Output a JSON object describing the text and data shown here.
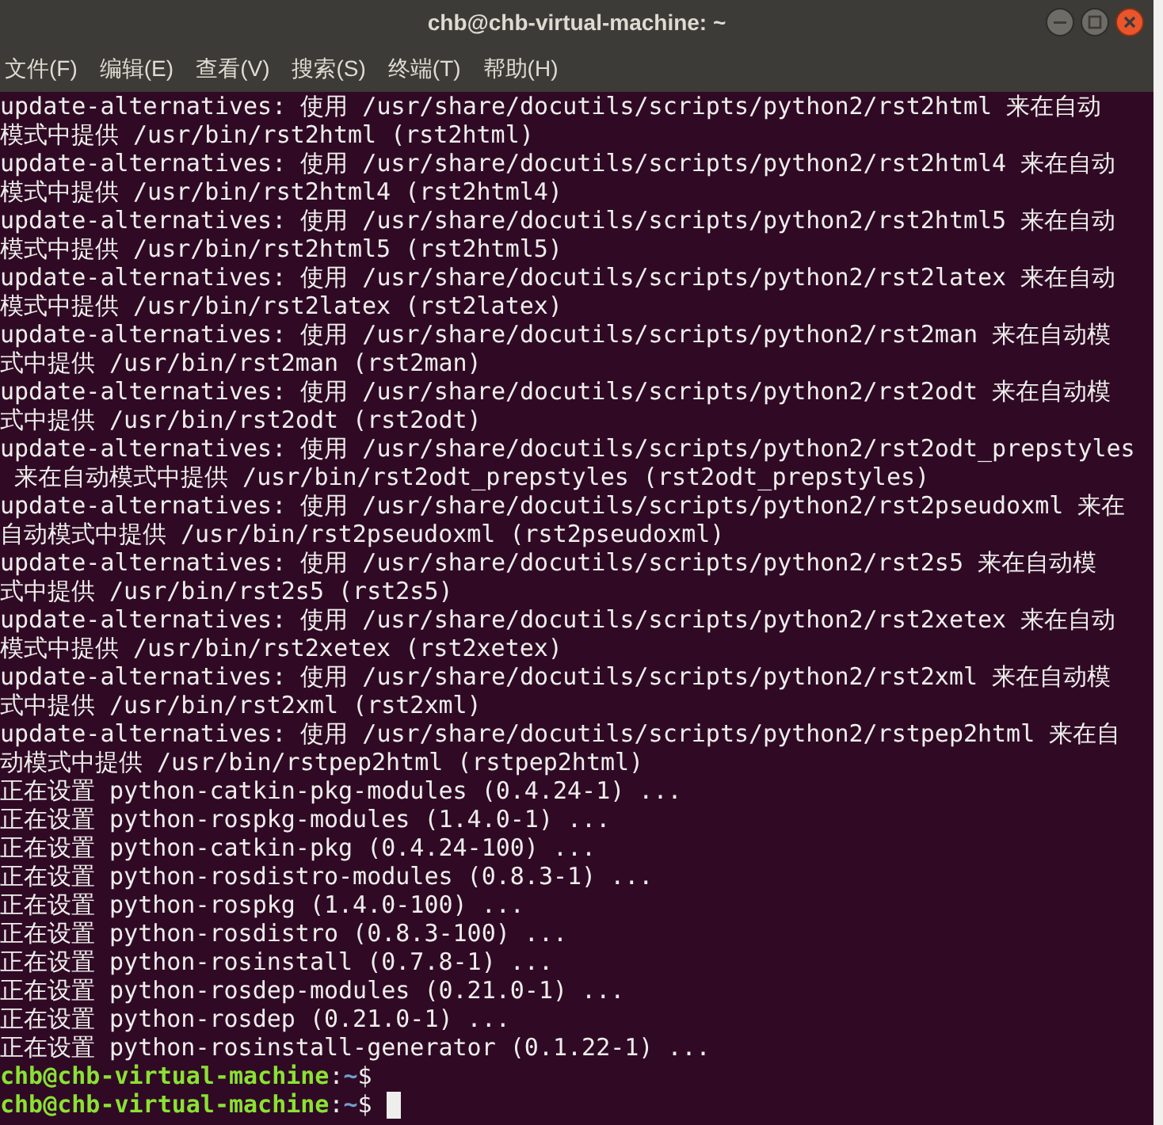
{
  "window": {
    "title": "chb@chb-virtual-machine: ~"
  },
  "menu": [
    "文件(F)",
    "编辑(E)",
    "查看(V)",
    "搜索(S)",
    "终端(T)",
    "帮助(H)"
  ],
  "lines": [
    {
      "kind": "output",
      "text": "update-alternatives: 使用 /usr/share/docutils/scripts/python2/rst2html 来在自动"
    },
    {
      "kind": "output",
      "text": "模式中提供 /usr/bin/rst2html (rst2html)"
    },
    {
      "kind": "output",
      "text": "update-alternatives: 使用 /usr/share/docutils/scripts/python2/rst2html4 来在自动"
    },
    {
      "kind": "output",
      "text": "模式中提供 /usr/bin/rst2html4 (rst2html4)"
    },
    {
      "kind": "output",
      "text": "update-alternatives: 使用 /usr/share/docutils/scripts/python2/rst2html5 来在自动"
    },
    {
      "kind": "output",
      "text": "模式中提供 /usr/bin/rst2html5 (rst2html5)"
    },
    {
      "kind": "output",
      "text": "update-alternatives: 使用 /usr/share/docutils/scripts/python2/rst2latex 来在自动"
    },
    {
      "kind": "output",
      "text": "模式中提供 /usr/bin/rst2latex (rst2latex)"
    },
    {
      "kind": "output",
      "text": "update-alternatives: 使用 /usr/share/docutils/scripts/python2/rst2man 来在自动模"
    },
    {
      "kind": "output",
      "text": "式中提供 /usr/bin/rst2man (rst2man)"
    },
    {
      "kind": "output",
      "text": "update-alternatives: 使用 /usr/share/docutils/scripts/python2/rst2odt 来在自动模"
    },
    {
      "kind": "output",
      "text": "式中提供 /usr/bin/rst2odt (rst2odt)"
    },
    {
      "kind": "output",
      "text": "update-alternatives: 使用 /usr/share/docutils/scripts/python2/rst2odt_prepstyles"
    },
    {
      "kind": "output",
      "text": " 来在自动模式中提供 /usr/bin/rst2odt_prepstyles (rst2odt_prepstyles)"
    },
    {
      "kind": "output",
      "text": "update-alternatives: 使用 /usr/share/docutils/scripts/python2/rst2pseudoxml 来在"
    },
    {
      "kind": "output",
      "text": "自动模式中提供 /usr/bin/rst2pseudoxml (rst2pseudoxml)"
    },
    {
      "kind": "output",
      "text": "update-alternatives: 使用 /usr/share/docutils/scripts/python2/rst2s5 来在自动模"
    },
    {
      "kind": "output",
      "text": "式中提供 /usr/bin/rst2s5 (rst2s5)"
    },
    {
      "kind": "output",
      "text": "update-alternatives: 使用 /usr/share/docutils/scripts/python2/rst2xetex 来在自动"
    },
    {
      "kind": "output",
      "text": "模式中提供 /usr/bin/rst2xetex (rst2xetex)"
    },
    {
      "kind": "output",
      "text": "update-alternatives: 使用 /usr/share/docutils/scripts/python2/rst2xml 来在自动模"
    },
    {
      "kind": "output",
      "text": "式中提供 /usr/bin/rst2xml (rst2xml)"
    },
    {
      "kind": "output",
      "text": "update-alternatives: 使用 /usr/share/docutils/scripts/python2/rstpep2html 来在自"
    },
    {
      "kind": "output",
      "text": "动模式中提供 /usr/bin/rstpep2html (rstpep2html)"
    },
    {
      "kind": "output",
      "text": "正在设置 python-catkin-pkg-modules (0.4.24-1) ..."
    },
    {
      "kind": "output",
      "text": "正在设置 python-rospkg-modules (1.4.0-1) ..."
    },
    {
      "kind": "output",
      "text": "正在设置 python-catkin-pkg (0.4.24-100) ..."
    },
    {
      "kind": "output",
      "text": "正在设置 python-rosdistro-modules (0.8.3-1) ..."
    },
    {
      "kind": "output",
      "text": "正在设置 python-rospkg (1.4.0-100) ..."
    },
    {
      "kind": "output",
      "text": "正在设置 python-rosdistro (0.8.3-100) ..."
    },
    {
      "kind": "output",
      "text": "正在设置 python-rosinstall (0.7.8-1) ..."
    },
    {
      "kind": "output",
      "text": "正在设置 python-rosdep-modules (0.21.0-1) ..."
    },
    {
      "kind": "output",
      "text": "正在设置 python-rosdep (0.21.0-1) ..."
    },
    {
      "kind": "output",
      "text": "正在设置 python-rosinstall-generator (0.1.22-1) ..."
    },
    {
      "kind": "prompt",
      "user": "chb@chb-virtual-machine",
      "colon": ":",
      "path": "~",
      "symbol": "$",
      "cursor": false
    },
    {
      "kind": "prompt",
      "user": "chb@chb-virtual-machine",
      "colon": ":",
      "path": "~",
      "symbol": "$",
      "cursor": true
    }
  ]
}
